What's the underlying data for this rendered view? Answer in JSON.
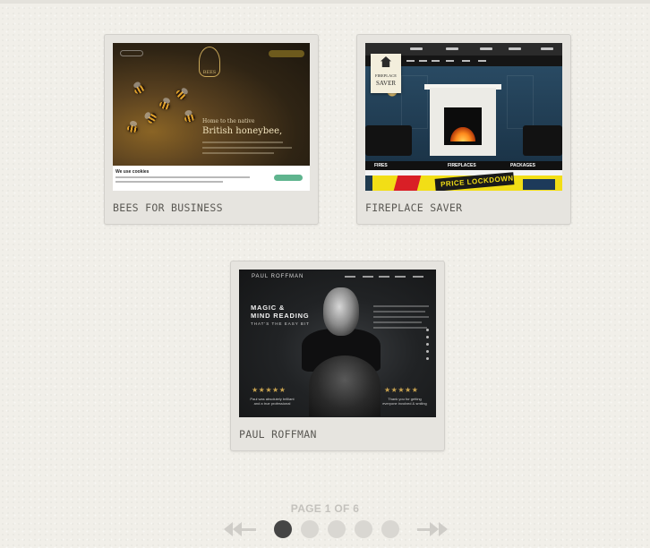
{
  "portfolio": {
    "items": [
      {
        "title": "BEES FOR BUSINESS",
        "preview": {
          "logo_text": "BEES",
          "hero_small": "Home to the native",
          "hero_big": "British honeybee,",
          "cookie_title": "We use cookies"
        }
      },
      {
        "title": "FIREPLACE SAVER",
        "preview": {
          "badge_line1": "FIREPLACE",
          "badge_line2": "SAVER",
          "categories": [
            "FIRES",
            "FIREPLACES",
            "PACKAGES"
          ],
          "promo_text": "PRICE LOCKDOWN"
        }
      },
      {
        "title": "PAUL ROFFMAN",
        "preview": {
          "brand": "PAUL ROFFMAN",
          "hero_line1": "MAGIC &",
          "hero_line2": "MIND READING",
          "hero_sub": "THAT'S THE EASY BIT",
          "stars": "★★★★★",
          "quote_left": "Paul was absolutely brilliant and a true professional",
          "quote_right": "Thank you for getting everyone involved & smiling"
        }
      }
    ]
  },
  "pagination": {
    "label": "PAGE 1 OF 6",
    "current_page": 1,
    "total_pages": 6,
    "visible_dots": 5,
    "prev_icon": "arrow-left-icon",
    "next_icon": "arrow-right-icon",
    "active_color": "#454545",
    "inactive_color": "#d9d7d2"
  }
}
